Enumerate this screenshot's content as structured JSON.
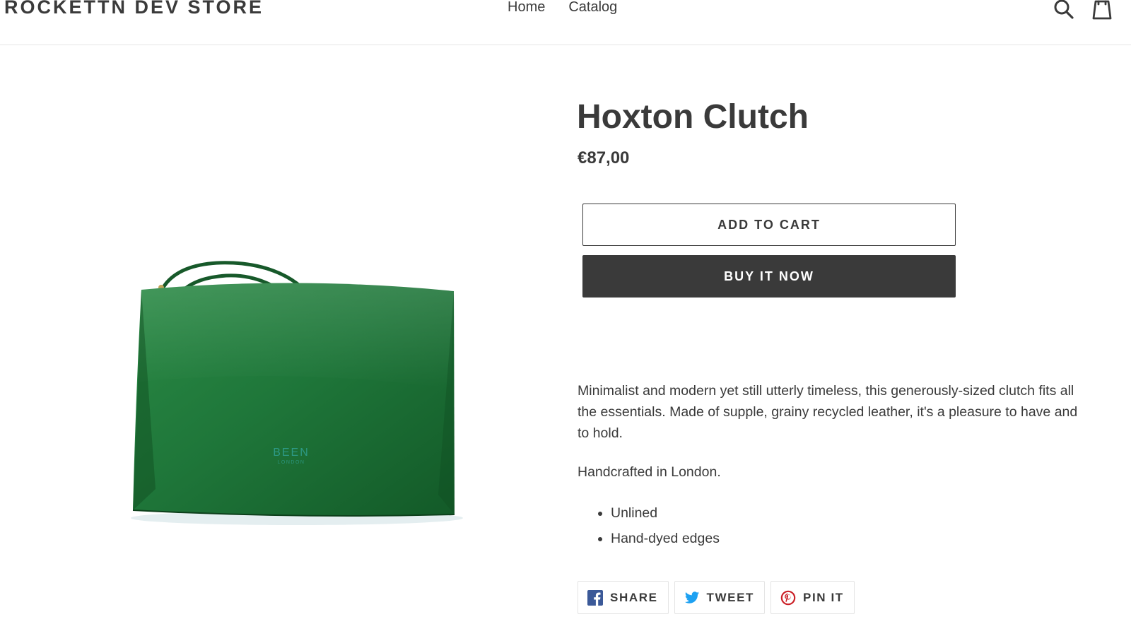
{
  "header": {
    "store_name": "ROCKETTN DEV STORE",
    "nav": [
      {
        "label": "Home"
      },
      {
        "label": "Catalog"
      }
    ]
  },
  "icons": {
    "search": "search-icon",
    "cart": "cart-icon",
    "facebook": "facebook-icon",
    "twitter": "twitter-icon",
    "pinterest": "pinterest-icon"
  },
  "product": {
    "title": "Hoxton Clutch",
    "price": "€87,00",
    "image_brand_text": "BEEN",
    "image_brand_sub": "LONDON",
    "add_to_cart": "Add to cart",
    "buy_it_now": "Buy it now",
    "description": [
      "Minimalist and modern yet still utterly timeless, this generously-sized clutch fits all the essentials. Made of supple, grainy recycled leather, it's a pleasure to have and to hold.",
      "Handcrafted in London."
    ],
    "features": [
      "Unlined",
      "Hand-dyed edges"
    ]
  },
  "share": {
    "facebook_label": "SHARE",
    "twitter_label": "TWEET",
    "pinterest_label": "PIN IT"
  },
  "colors": {
    "text": "#3a3a3a",
    "buy_button": "#3a3a3a",
    "bag_green": "#1b6b33",
    "facebook": "#3b5998",
    "twitter": "#00aced",
    "pinterest": "#cb2027"
  }
}
